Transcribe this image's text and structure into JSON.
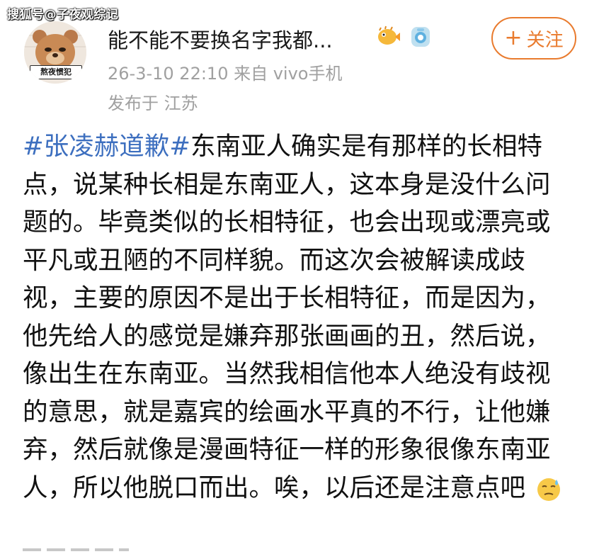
{
  "watermark": "搜狐号@子夜观综记",
  "user": {
    "name": "能不能不要换名字我都...",
    "avatar_badge": "熬夜惯犯",
    "badges": [
      "blowfish-emoji-icon",
      "camera-badge-icon"
    ]
  },
  "follow": {
    "plus": "+",
    "label": "关注",
    "color": "#e97b2e"
  },
  "meta": {
    "time_source": "26-3-10 22:10  来自 vivo手机",
    "location": "发布于 江苏"
  },
  "post": {
    "hashtag": "#张凌赫道歉#",
    "text": "东南亚人确实是有那样的长相特点，说某种长相是东南亚人，这本身是没什么问题的。毕竟类似的长相特征，也会出现或漂亮或平凡或丑陋的不同样貌。而这次会被解读成歧视，主要的原因不是出于长相特征，而是因为，他先给人的感觉是嫌弃那张画画的丑，然后说，像出生在东南亚。当然我相信他本人绝没有歧视的意思，就是嘉宾的绘画水平真的不行，让他嫌弃，然后就像是漫画特征一样的形象很像东南亚人，所以他脱口而出。唉，以后还是注意点吧",
    "end_emoji": "sweat-face-emoji-icon",
    "hashtag_color": "#3d6fbf"
  }
}
